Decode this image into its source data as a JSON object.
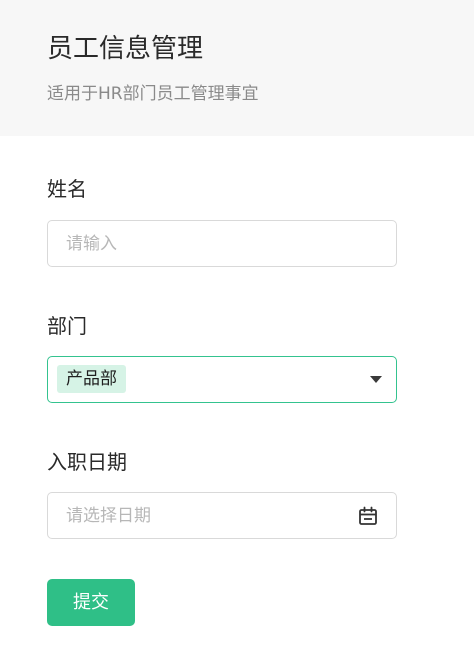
{
  "header": {
    "title": "员工信息管理",
    "subtitle": "适用于HR部门员工管理事宜"
  },
  "form": {
    "name": {
      "label": "姓名",
      "placeholder": "请输入",
      "value": ""
    },
    "department": {
      "label": "部门",
      "selected": "产品部",
      "icon": "caret-down-icon"
    },
    "hire_date": {
      "label": "入职日期",
      "placeholder": "请选择日期",
      "icon": "calendar-icon"
    },
    "submit_label": "提交"
  },
  "colors": {
    "accent": "#2fbf87",
    "tag_background": "#d6f3e6",
    "header_background": "#f7f7f7"
  }
}
